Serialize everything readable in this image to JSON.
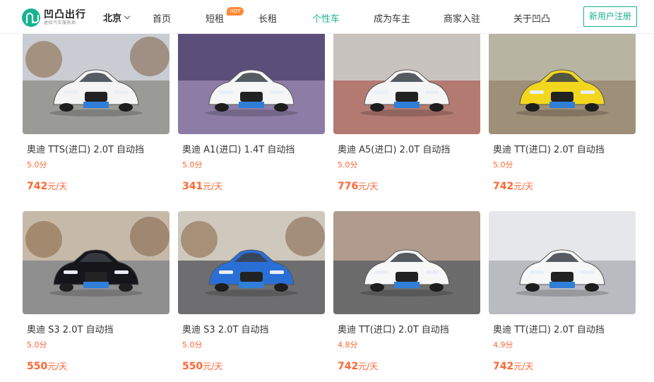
{
  "logo": {
    "name": "凹凸出行",
    "tagline": "虚拟汽车服务商"
  },
  "city": "北京",
  "nav": [
    {
      "label": "首页"
    },
    {
      "label": "短租",
      "badge": "HOT"
    },
    {
      "label": "长租"
    },
    {
      "label": "个性车",
      "active": true
    },
    {
      "label": "成为车主"
    },
    {
      "label": "商家入驻"
    },
    {
      "label": "关于凹凸"
    }
  ],
  "register_label": "新用户注册",
  "colors": {
    "accent": "#19b28f",
    "price": "#ff6633",
    "hot_badge": "#ff8a3a"
  },
  "price_unit": "元/天",
  "cars": [
    {
      "title": "奥迪 TTS(进口) 2.0T 自动挡",
      "rating": "5.0分",
      "price": "742",
      "car_color": "#f4f4f4"
    },
    {
      "title": "奥迪 A1(进口) 1.4T 自动挡",
      "rating": "5.0分",
      "price": "341",
      "car_color": "#f6f6f6"
    },
    {
      "title": "奥迪 A5(进口) 2.0T 自动挡",
      "rating": "5.0分",
      "price": "776",
      "car_color": "#f5f5f5"
    },
    {
      "title": "奥迪 TT(进口) 2.0T 自动挡",
      "rating": "5.0分",
      "price": "742",
      "car_color": "#f2d71e"
    },
    {
      "title": "奥迪 S3 2.0T 自动挡",
      "rating": "5.0分",
      "price": "550",
      "car_color": "#15151a"
    },
    {
      "title": "奥迪 S3 2.0T 自动挡",
      "rating": "5.0分",
      "price": "550",
      "car_color": "#2a6fd6"
    },
    {
      "title": "奥迪 TT(进口) 2.0T 自动挡",
      "rating": "4.8分",
      "price": "742",
      "car_color": "#f7f7f7"
    },
    {
      "title": "奥迪 TT(进口) 2.0T 自动挡",
      "rating": "4.9分",
      "price": "742",
      "car_color": "#f7f7f7"
    }
  ]
}
